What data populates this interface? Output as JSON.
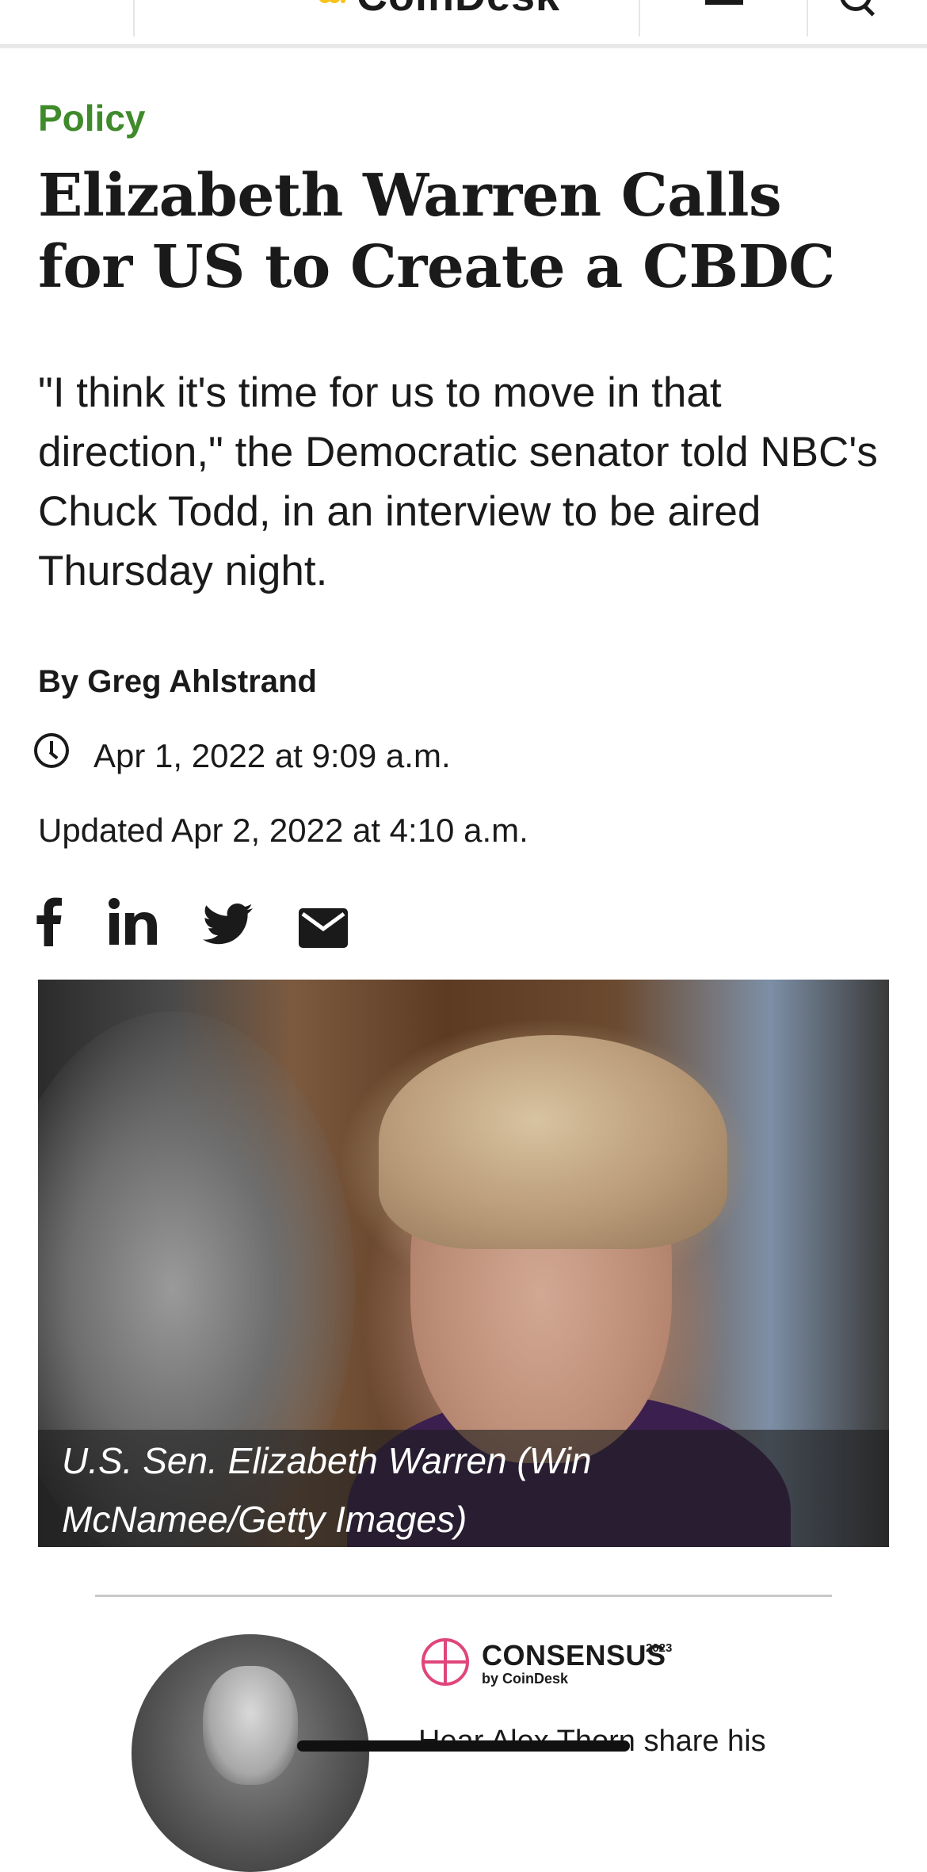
{
  "nav": {
    "logo_text": "CoinDesk",
    "menu_icon": "hamburger-menu-icon",
    "search_icon": "search-icon"
  },
  "article": {
    "category": "Policy",
    "headline": "Elizabeth Warren Calls for US to Create a CBDC",
    "dek": "\"I think it's time for us to move in that direction,\" the Democratic senator told NBC's Chuck Todd, in an interview to be aired Thursday night.",
    "byline": "By Greg Ahlstrand",
    "published": "Apr 1, 2022 at 9:09 a.m.",
    "updated": "Updated Apr 2, 2022 at 4:10 a.m.",
    "share_icons": [
      "facebook-icon",
      "linkedin-icon",
      "twitter-icon",
      "email-icon"
    ],
    "image_caption": "U.S. Sen. Elizabeth Warren (Win McNamee/Getty Images)"
  },
  "promo": {
    "brand": "CONSENSUS",
    "brand_year": "2023",
    "brand_by": "by CoinDesk",
    "text": "Hear Alex Thorn share his"
  },
  "colors": {
    "category": "#3f8a2b",
    "text": "#1a1a1a",
    "logo_accent": "#f7c21c",
    "consensus_accent": "#e0457b"
  }
}
